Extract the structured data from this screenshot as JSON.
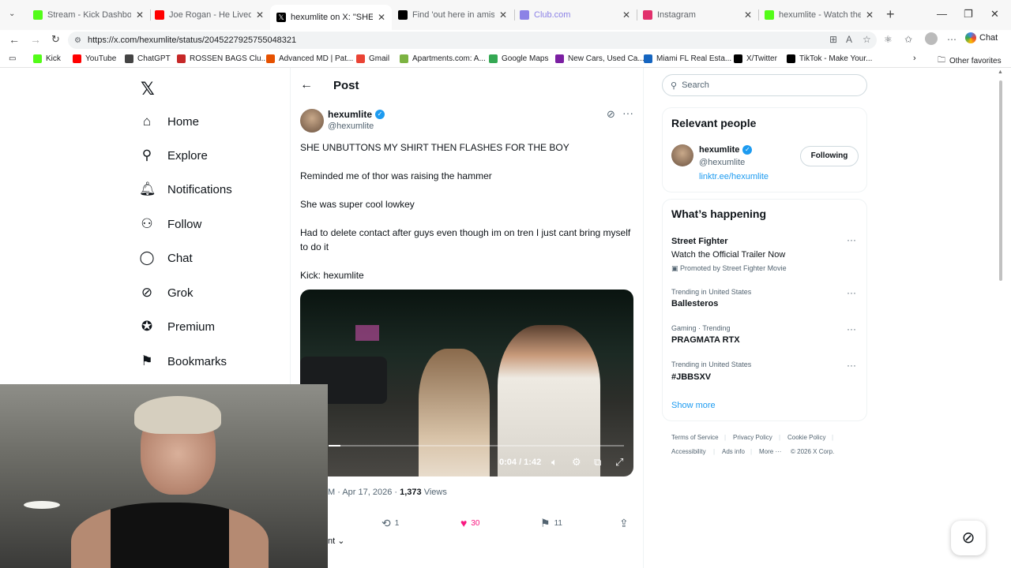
{
  "browser": {
    "tabs": [
      {
        "title": "Stream - Kick Dashboard",
        "color": "#53fc18"
      },
      {
        "title": "Joe Rogan - He Lived With N",
        "color": "#ff0000"
      },
      {
        "title": "hexumlite on X: \"SHE UNBU",
        "color": "#000000"
      },
      {
        "title": "Find 'out here in amish doin",
        "color": "#000000"
      },
      {
        "title": "Club.com",
        "color": "#8c82e6"
      },
      {
        "title": "Instagram",
        "color": "#e1306c"
      },
      {
        "title": "hexumlite - Watch the VOD",
        "color": "#53fc18"
      }
    ],
    "url": "https://x.com/hexumlite/status/2045227925755048321",
    "chat_label": "Chat",
    "bookmarks": [
      {
        "label": "Kick",
        "color": "#53fc18"
      },
      {
        "label": "YouTube",
        "color": "#ff0000"
      },
      {
        "label": "ChatGPT",
        "color": "#444444"
      },
      {
        "label": "ROSSEN BAGS Clu...",
        "color": "#c62828"
      },
      {
        "label": "Advanced MD | Pat...",
        "color": "#e65100"
      },
      {
        "label": "Gmail",
        "color": "#ea4335"
      },
      {
        "label": "Apartments.com: A...",
        "color": "#7cb342"
      },
      {
        "label": "Google Maps",
        "color": "#34a853"
      },
      {
        "label": "New Cars, Used Ca...",
        "color": "#7b1fa2"
      },
      {
        "label": "Miami FL Real Esta...",
        "color": "#1565c0"
      },
      {
        "label": "X/Twitter",
        "color": "#000000"
      },
      {
        "label": "TikTok - Make Your...",
        "color": "#000000"
      }
    ],
    "other_favorites": "Other favorites"
  },
  "nav": {
    "items": [
      {
        "label": "Home",
        "icon": "⌂"
      },
      {
        "label": "Explore",
        "icon": "⚲"
      },
      {
        "label": "Notifications",
        "icon": "🔔︎"
      },
      {
        "label": "Follow",
        "icon": "⚇"
      },
      {
        "label": "Chat",
        "icon": "◯"
      },
      {
        "label": "Grok",
        "icon": "⊘"
      },
      {
        "label": "Premium",
        "icon": "✪"
      },
      {
        "label": "Bookmarks",
        "icon": "⚑"
      }
    ]
  },
  "post": {
    "header_title": "Post",
    "author_name": "hexumlite",
    "author_handle": "@hexumlite",
    "lines": [
      "SHE UNBUTTONS MY SHIRT THEN FLASHES FOR THE BOY",
      "Reminded me of thor was raising the hammer",
      "She was super cool lowkey",
      "Had to delete contact after guys even though im on tren I just cant bring myself to do it",
      "Kick: hexumlite"
    ],
    "video_time": "0:04 / 1:42",
    "video_progress": 0.04,
    "meta_date": "M · Apr 17, 2026 · ",
    "views_count": "1,373",
    "views_label": " Views",
    "reposts": "1",
    "likes": "30",
    "bookmarks": "11",
    "sort_label": "nt"
  },
  "sidebar": {
    "search_placeholder": "Search",
    "relevant_title": "Relevant people",
    "person_name": "hexumlite",
    "person_handle": "@hexumlite",
    "person_link": "linktr.ee/hexumlite",
    "following_label": "Following",
    "happening_title": "What’s happening",
    "promo_title": "Street Fighter",
    "promo_line": "Watch the Official Trailer Now",
    "promo_by": "Promoted by Street Fighter Movie",
    "trends": [
      {
        "sub": "Trending in United States",
        "title": "Ballesteros"
      },
      {
        "sub": "Gaming · Trending",
        "title": "PRAGMATA RTX"
      },
      {
        "sub": "Trending in United States",
        "title": "#JBBSXV"
      }
    ],
    "show_more": "Show more",
    "footer": [
      "Terms of Service",
      "Privacy Policy",
      "Cookie Policy",
      "Accessibility",
      "Ads info",
      "More ···",
      "© 2026 X Corp."
    ]
  }
}
